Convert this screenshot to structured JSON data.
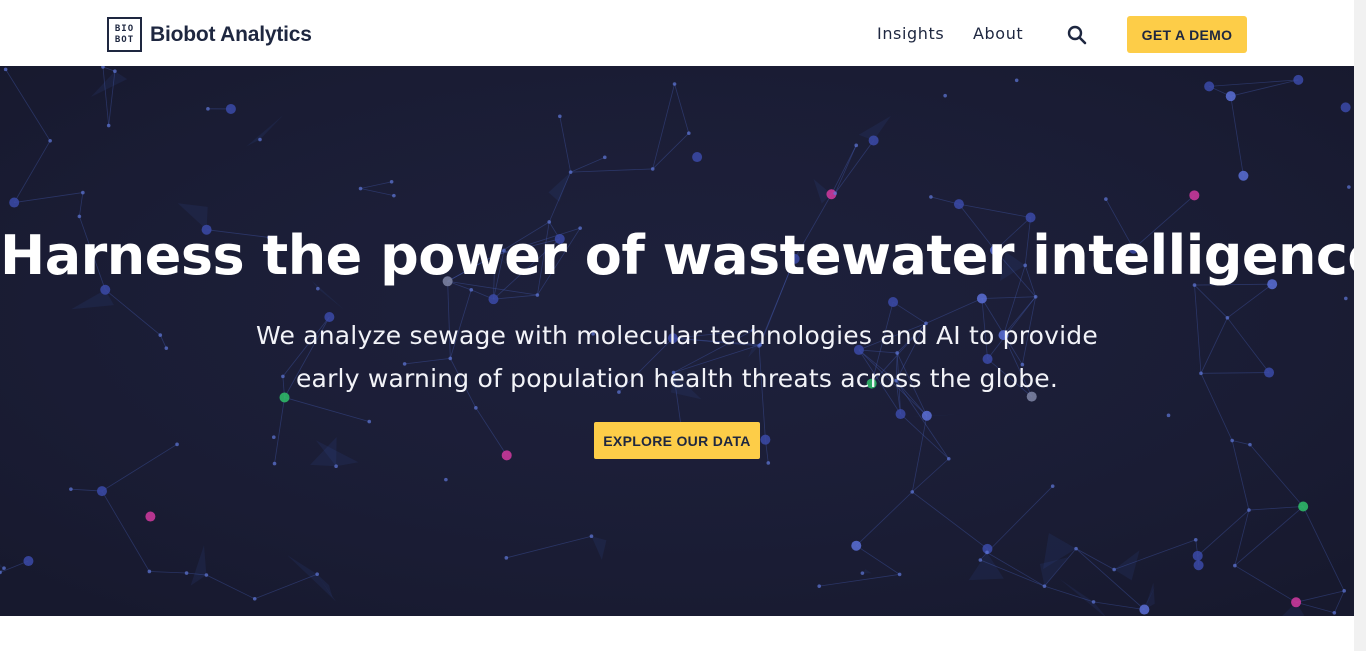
{
  "header": {
    "logo_mark_line1": "BIO",
    "logo_mark_line2": "BOT",
    "logo_text": "Biobot Analytics",
    "nav": [
      {
        "label": "Insights"
      },
      {
        "label": "About"
      }
    ],
    "search_icon": "search-icon",
    "demo_button": "GET A DEMO"
  },
  "hero": {
    "title": "Harness the power of wastewater intelligence",
    "subtitle": "We analyze sewage with molecular technologies and AI to provide early warning of population health threats across the globe.",
    "cta_button": "EXPLORE OUR DATA",
    "background": "network-graph-particles"
  },
  "colors": {
    "navy": "#1e2740",
    "hero_bg": "#1b1d33",
    "accent_yellow": "#fdcd48",
    "node_blue": "#3b4aa8",
    "node_green": "#2fbf6a",
    "node_pink": "#d23aa0"
  }
}
